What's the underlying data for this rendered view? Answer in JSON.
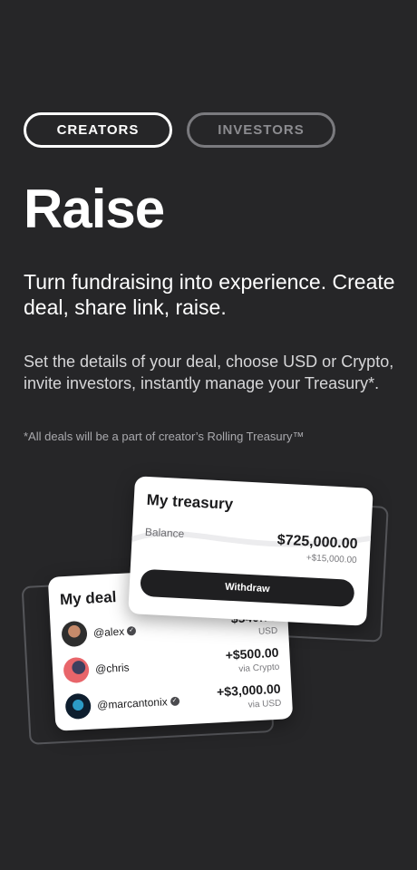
{
  "tabs": [
    {
      "label": "CREATORS",
      "active": true
    },
    {
      "label": "INVESTORS",
      "active": false
    }
  ],
  "hero": {
    "title": "Raise",
    "subtitle": "Turn fundraising into experience. Create deal, share link, raise.",
    "description": "Set the details of your deal, choose USD or Crypto, invite investors, instantly manage your Treasury*.",
    "note": "*All deals will be a part of creator’s Rolling Treasury™"
  },
  "deal_card": {
    "title": "My deal",
    "rows": [
      {
        "handle": "@alex",
        "verified": true,
        "amount": "$540.73",
        "via": "USD"
      },
      {
        "handle": "@chris",
        "verified": false,
        "amount": "+$500.00",
        "via": "via Crypto"
      },
      {
        "handle": "@marcantonix",
        "verified": true,
        "amount": "+$3,000.00",
        "via": "via USD"
      }
    ]
  },
  "treasury_card": {
    "title": "My treasury",
    "balance_label": "Balance",
    "balance_value": "$725,000.00",
    "balance_change": "+$15,000.00",
    "withdraw_label": "Withdraw"
  },
  "colors": {
    "background": "#262628",
    "card": "#ffffff",
    "button": "#1f1f21",
    "tab_inactive": "#7a7a7e"
  }
}
